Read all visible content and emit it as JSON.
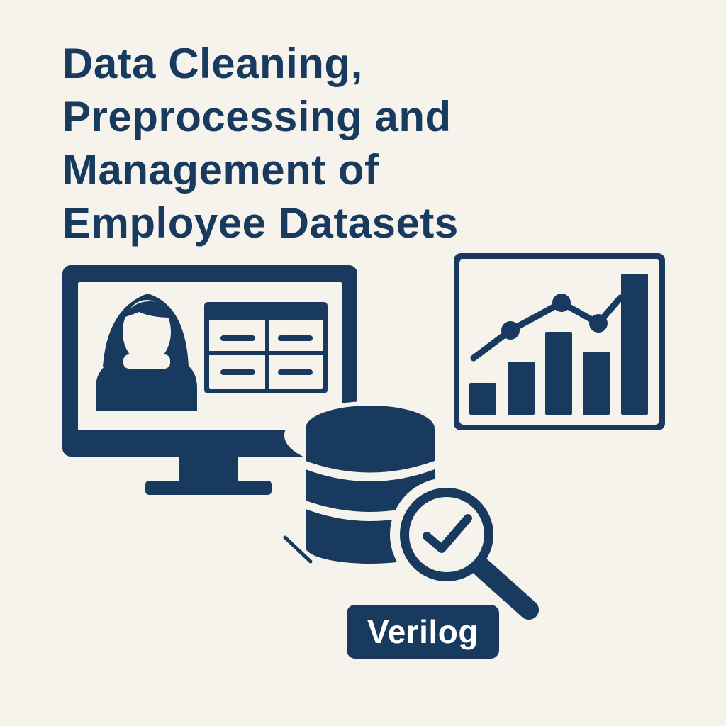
{
  "title": {
    "lines": [
      "Data Cleaning,",
      "Preprocessing and",
      "Management of",
      "Employee Datasets"
    ]
  },
  "badge": {
    "label": "Verilog"
  },
  "icons": {
    "monitor": "monitor-icon",
    "employee": "employee-avatar-icon",
    "table": "data-table-icon",
    "chart": "bar-line-chart-icon",
    "database": "database-icon",
    "magnifier": "magnifier-check-icon"
  },
  "colors": {
    "background": "#f6f3ed",
    "primary": "#173a5e"
  }
}
